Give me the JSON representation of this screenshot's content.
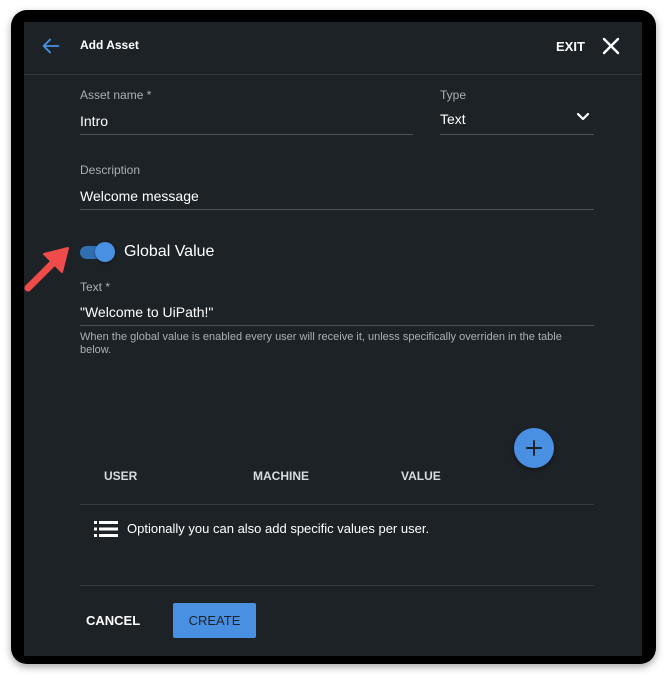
{
  "header": {
    "title": "Add Asset",
    "exit_label": "EXIT"
  },
  "form": {
    "asset_name": {
      "label": "Asset name *",
      "value": "Intro"
    },
    "type": {
      "label": "Type",
      "value": "Text"
    },
    "description": {
      "label": "Description",
      "value": "Welcome message"
    },
    "global_value": {
      "label": "Global Value",
      "enabled": true
    },
    "text": {
      "label": "Text *",
      "value": "\"Welcome to UiPath!\""
    },
    "hint": "When the global value is enabled every user will receive it, unless specifically overriden in the table below."
  },
  "table": {
    "columns": [
      "USER",
      "MACHINE",
      "VALUE"
    ],
    "empty_message": "Optionally you can also add specific values per user."
  },
  "footer": {
    "cancel_label": "CANCEL",
    "create_label": "CREATE"
  },
  "colors": {
    "background": "#1d2227",
    "accent": "#4a90e2",
    "annotation_arrow": "#f04b4b"
  }
}
